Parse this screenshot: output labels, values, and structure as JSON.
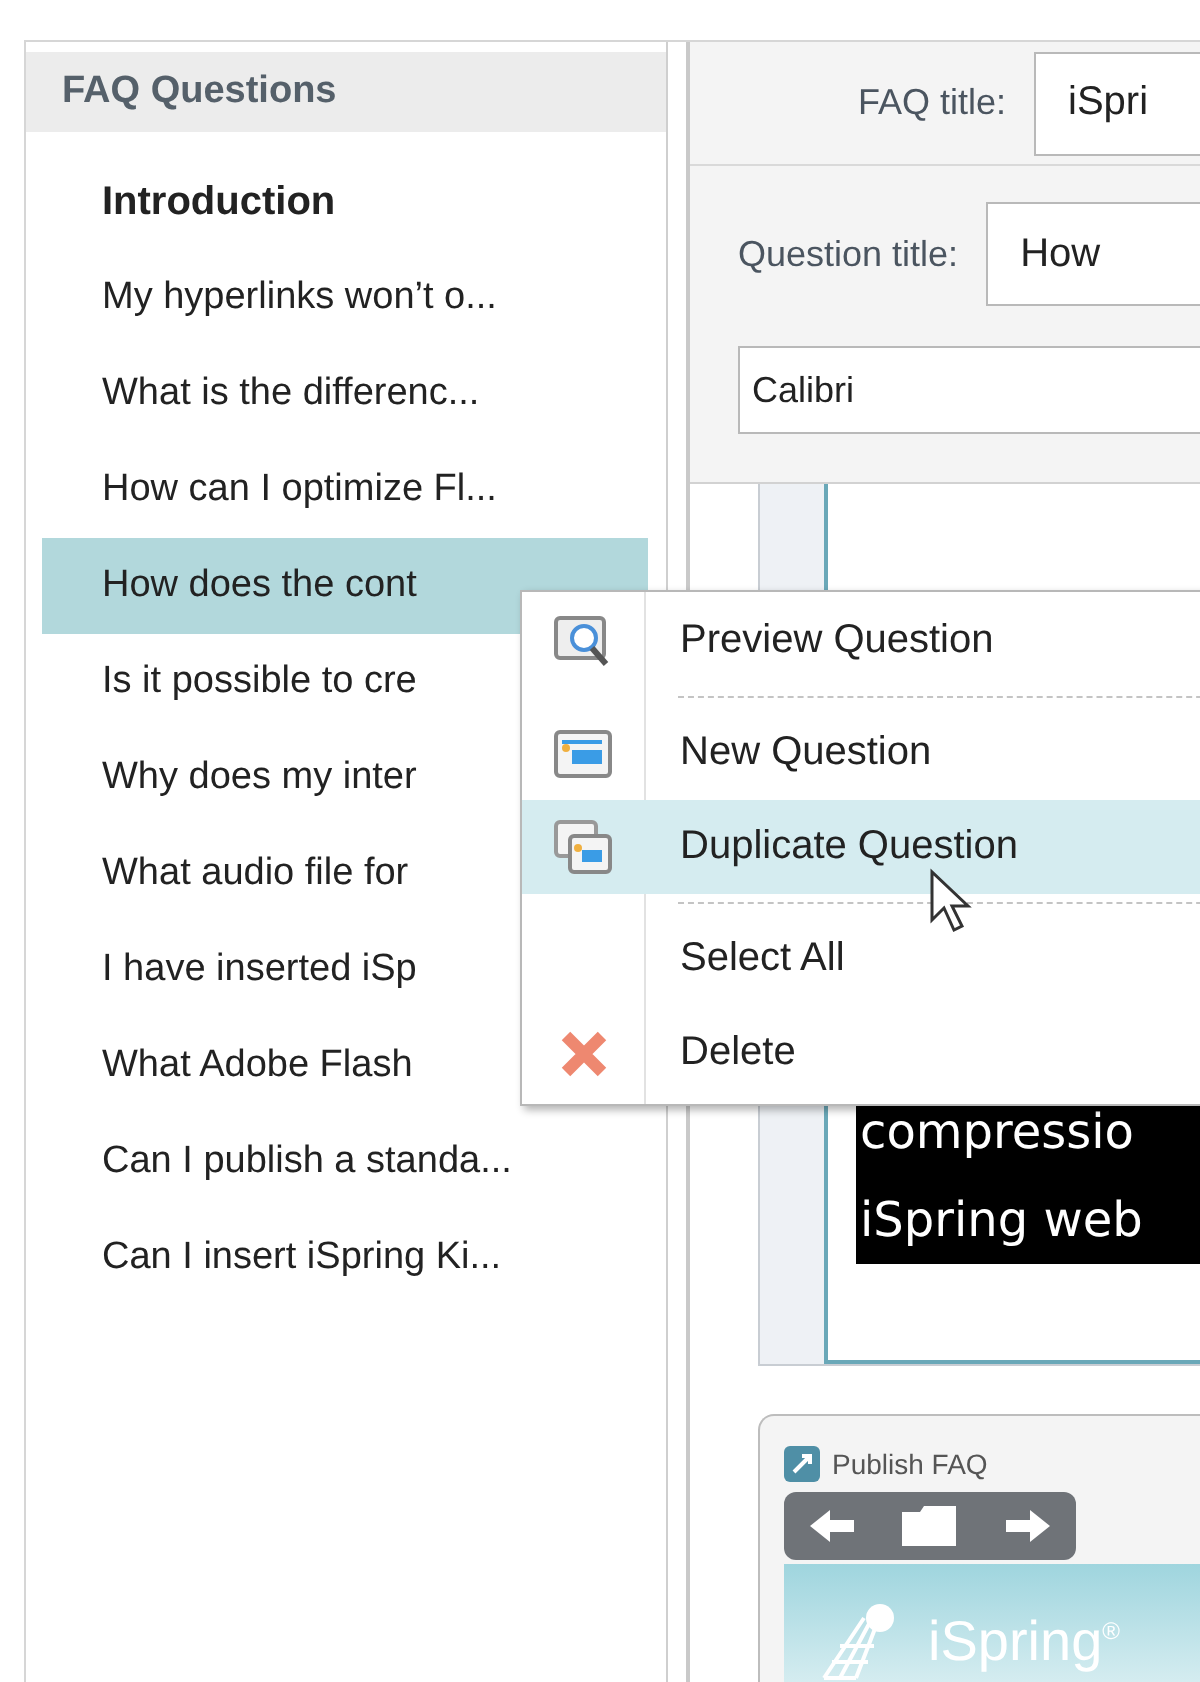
{
  "sidebar": {
    "title": "FAQ Questions",
    "items": [
      {
        "label": "Introduction",
        "kind": "heading",
        "selected": false
      },
      {
        "label": "My hyperlinks won’t o...",
        "kind": "question",
        "selected": false
      },
      {
        "label": "What is the differenc...",
        "kind": "question",
        "selected": false
      },
      {
        "label": "How can I optimize Fl...",
        "kind": "question",
        "selected": false
      },
      {
        "label": "How does the cont",
        "kind": "question",
        "selected": true
      },
      {
        "label": "Is it possible to cre",
        "kind": "question",
        "selected": false
      },
      {
        "label": "Why does my inter",
        "kind": "question",
        "selected": false
      },
      {
        "label": "What audio file for",
        "kind": "question",
        "selected": false
      },
      {
        "label": "I have inserted iSp",
        "kind": "question",
        "selected": false
      },
      {
        "label": "What Adobe Flash",
        "kind": "question",
        "selected": false
      },
      {
        "label": "Can I publish a standa...",
        "kind": "question",
        "selected": false
      },
      {
        "label": "Can I insert iSpring Ki...",
        "kind": "question",
        "selected": false
      }
    ]
  },
  "form": {
    "faq_title_label": "FAQ title:",
    "faq_title_value": "iSpri",
    "question_title_label": "Question title:",
    "question_title_value": "How",
    "font": "Calibri"
  },
  "editor": {
    "lines": [
      "compressio",
      "iSpring web"
    ]
  },
  "preview": {
    "title": "Publish FAQ",
    "logo": "iSpring",
    "logo_mark": "®"
  },
  "context_menu": {
    "items": [
      {
        "kind": "preview",
        "label": "Preview Question",
        "selected": false
      },
      {
        "kind": "separator"
      },
      {
        "kind": "new",
        "label": "New Question",
        "selected": false
      },
      {
        "kind": "duplicate",
        "label": "Duplicate Question",
        "selected": true
      },
      {
        "kind": "separator"
      },
      {
        "kind": "plain",
        "label": "Select All",
        "selected": false
      },
      {
        "kind": "delete",
        "label": "Delete",
        "selected": false
      }
    ]
  }
}
